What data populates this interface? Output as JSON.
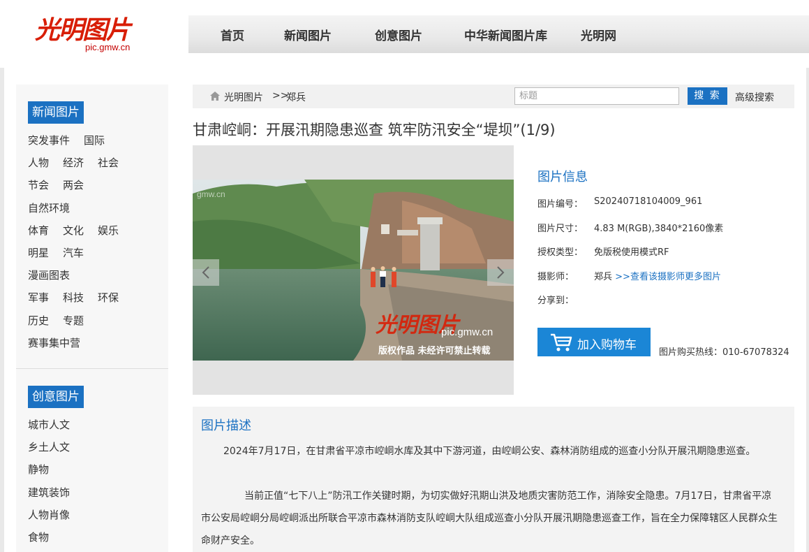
{
  "logo": {
    "cn": "光明图片",
    "url": "pic.gmw.cn"
  },
  "nav": [
    "首页",
    "新闻图片",
    "创意图片",
    "中华新闻图片库",
    "光明网"
  ],
  "sidebar": {
    "news_title": "新闻图片",
    "news_rows": [
      [
        "突发事件",
        "国际"
      ],
      [
        "人物",
        "经济",
        "社会"
      ],
      [
        "节会",
        "两会"
      ],
      [
        "自然环境"
      ],
      [
        "体育",
        "文化",
        "娱乐"
      ],
      [
        "明星",
        "汽车"
      ],
      [
        "漫画图表"
      ],
      [
        "军事",
        "科技",
        "环保"
      ],
      [
        "历史",
        "专题"
      ],
      [
        "赛事集中营"
      ]
    ],
    "creative_title": "创意图片",
    "creative_rows": [
      [
        "城市人文"
      ],
      [
        "乡土人文"
      ],
      [
        "静物"
      ],
      [
        "建筑装饰"
      ],
      [
        "人物肖像"
      ],
      [
        "食物"
      ]
    ]
  },
  "breadcrumb": {
    "home": "光明图片",
    "sep": ">>",
    "current": "郑兵"
  },
  "search": {
    "placeholder": "标题",
    "button": "搜 索",
    "advanced": "高级搜索"
  },
  "title": "甘肃崆峒：开展汛期隐患巡查 筑牢防汛安全“堤坝”(1/9)",
  "photo": {
    "watermark_url": "pic.gmw.cn",
    "copyright": "版权作品  未经许可禁止转载",
    "corner_mark": "gmw.cn"
  },
  "info": {
    "heading": "图片信息",
    "id_label": "图片编号：",
    "id_value": "S20240718104009_961",
    "size_label": "图片尺寸：",
    "size_value": "4.83 M(RGB),3840*2160像素",
    "license_label": "授权类型：",
    "license_value": "免版税使用模式RF",
    "photographer_label": "摄影师：",
    "photographer_value": "郑兵",
    "photographer_link": ">>查看该摄影师更多图片",
    "share_label": "分享到："
  },
  "cart": {
    "label": "加入购物车"
  },
  "hotline": "图片购买热线：010-67078324",
  "description": {
    "heading": "图片描述",
    "p1": "2024年7月17日，在甘肃省平凉市崆峒水库及其中下游河道，由崆峒公安、森林消防组成的巡查小分队开展汛期隐患巡查。",
    "p2": "当前正值“七下八上”防汛工作关键时期，为切实做好汛期山洪及地质灾害防范工作，消除安全隐患。7月17日，甘肃省平凉市公安局崆峒分局崆峒派出所联合平凉市森林消防支队崆峒大队组成巡查小分队开展汛期隐患巡查工作，旨在全力保障辖区人民群众生命财产安全。"
  },
  "colors": {
    "accent": "#1b71c2",
    "cart": "#1b86d6",
    "logo_red": "#d81e06"
  }
}
